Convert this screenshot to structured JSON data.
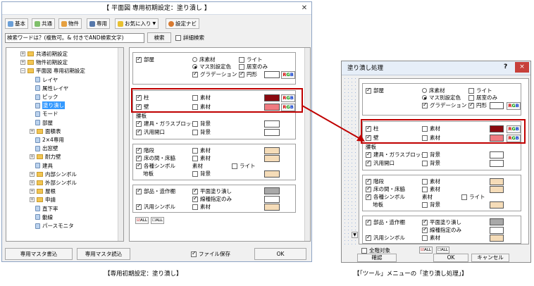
{
  "main_window": {
    "title": "【 平面図 専用初期設定：塗り潰し 】",
    "toolbar": {
      "basic": "基本",
      "common": "共通",
      "property": "物件",
      "dedicated": "専用",
      "favorites": "お気に入り",
      "favorites_arrow": "▼",
      "settings_navi": "設定ナビ"
    },
    "search": {
      "value": "検索ワードは？(複数可。& 付きでAND検索文字)",
      "button": "検索",
      "detail_label": "詳細検索"
    },
    "tree": [
      {
        "label": "共通初期設定",
        "expander": "+",
        "type": "folder"
      },
      {
        "label": "物件初期設定",
        "expander": "+",
        "type": "folder"
      },
      {
        "label": "平面図 専用初期設定",
        "expander": "−",
        "type": "folder"
      },
      {
        "label": "レイヤ",
        "type": "leaf"
      },
      {
        "label": "属性レイヤ",
        "type": "leaf"
      },
      {
        "label": "ピック",
        "type": "leaf"
      },
      {
        "label": "塗り潰し",
        "type": "leaf",
        "selected": true
      },
      {
        "label": "モード",
        "type": "leaf"
      },
      {
        "label": "部屋",
        "type": "leaf"
      },
      {
        "label": "面積表",
        "expander": "+",
        "type": "folder"
      },
      {
        "label": "2×4専用",
        "type": "leaf"
      },
      {
        "label": "出窓壁",
        "type": "leaf"
      },
      {
        "label": "耐力壁",
        "expander": "+",
        "type": "folder"
      },
      {
        "label": "建具",
        "type": "leaf"
      },
      {
        "label": "内部シンボル",
        "expander": "+",
        "type": "folder"
      },
      {
        "label": "外部シンボル",
        "expander": "+",
        "type": "folder"
      },
      {
        "label": "屋根",
        "expander": "+",
        "type": "folder"
      },
      {
        "label": "申請",
        "expander": "+",
        "type": "folder"
      },
      {
        "label": "直下率",
        "type": "leaf"
      },
      {
        "label": "動線",
        "type": "leaf"
      },
      {
        "label": "パースモニタ",
        "type": "leaf"
      }
    ],
    "bottom": {
      "write_master": "専用マスタ書込",
      "read_master": "専用マスタ読込",
      "save_file": "ファイル保存",
      "ok": "OK"
    }
  },
  "fill_settings": {
    "room": "部屋",
    "floor_material": "床素材",
    "light": "ライト",
    "mass_color": "マス別設定色",
    "room_only": "居室のみ",
    "gradation": "グラデーション",
    "circle": "円形",
    "pillar": "柱",
    "wall": "壁",
    "material": "素材",
    "skirt": "腰板",
    "fittings": "建具・ガラスブロック",
    "background": "背景",
    "general_opening": "汎用開口",
    "stairs": "階段",
    "floor_space": "床の間・床脇",
    "symbols": "各種シンボル",
    "ground": "地板",
    "parts": "部品・造作棚",
    "plane_fill": "平面塗り潰し",
    "line_type": "線種指定のみ",
    "general_symbol": "汎用シンボル",
    "rgb": {
      "r": "R",
      "g": "G",
      "b": "B"
    },
    "all_on": "ALL",
    "all_off": "ALL"
  },
  "dialog": {
    "title": "塗り潰し処理",
    "help": "?",
    "close": "×",
    "all_floors": "全階対象",
    "confirm": "確認",
    "ok": "OK",
    "cancel": "キャンセル"
  },
  "captions": {
    "left": "【専用初期設定：塗り潰し】",
    "right": "【「ツール」メニューの「塗り潰し処理」】"
  },
  "colors": {
    "pillar": "#8b0a10",
    "wall": "#f07a80",
    "beige": "#f5dcb8",
    "gray": "#a8a8a8",
    "highlight_frame": "#c00000",
    "selection": "#3399ff"
  }
}
